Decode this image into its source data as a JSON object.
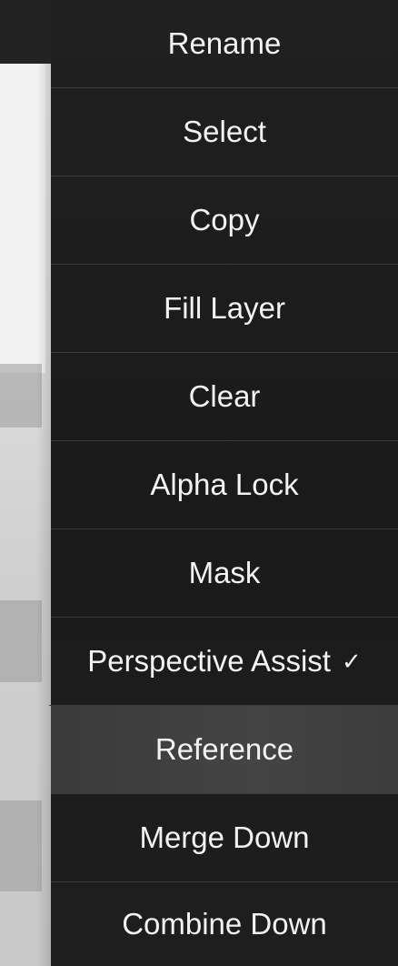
{
  "menu": {
    "items": [
      {
        "label": "Rename",
        "checked": false,
        "highlighted": false
      },
      {
        "label": "Select",
        "checked": false,
        "highlighted": false
      },
      {
        "label": "Copy",
        "checked": false,
        "highlighted": false
      },
      {
        "label": "Fill Layer",
        "checked": false,
        "highlighted": false
      },
      {
        "label": "Clear",
        "checked": false,
        "highlighted": false
      },
      {
        "label": "Alpha Lock",
        "checked": false,
        "highlighted": false
      },
      {
        "label": "Mask",
        "checked": false,
        "highlighted": false
      },
      {
        "label": "Perspective Assist",
        "checked": true,
        "highlighted": false
      },
      {
        "label": "Reference",
        "checked": false,
        "highlighted": true
      },
      {
        "label": "Merge Down",
        "checked": false,
        "highlighted": false
      },
      {
        "label": "Combine Down",
        "checked": false,
        "highlighted": false
      }
    ],
    "check_glyph": "✓"
  },
  "colors": {
    "menu_background": "#1c1c1c",
    "menu_text": "#f2f2f2",
    "divider": "#3a3a3a",
    "highlight": "#404040"
  }
}
